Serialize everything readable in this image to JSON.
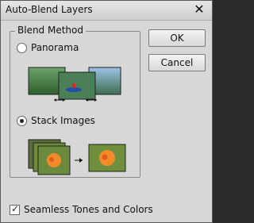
{
  "window": {
    "title": "Auto-Blend Layers"
  },
  "icons": {
    "close": "close-icon",
    "panorama": "panorama-illustration",
    "stack": "stack-images-illustration",
    "arrow": "arrow-right-icon"
  },
  "group": {
    "label": "Blend Method"
  },
  "options": [
    {
      "label": "Panorama",
      "selected": false
    },
    {
      "label": "Stack Images",
      "selected": true
    }
  ],
  "buttons": {
    "ok": "OK",
    "cancel": "Cancel"
  },
  "checkbox": {
    "label": "Seamless Tones and Colors",
    "checked": true
  }
}
